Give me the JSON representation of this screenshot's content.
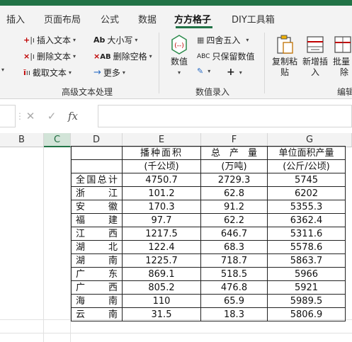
{
  "ribbon_tabs": [
    {
      "label": "插入",
      "active": false
    },
    {
      "label": "页面布局",
      "active": false
    },
    {
      "label": "公式",
      "active": false
    },
    {
      "label": "数据",
      "active": false
    },
    {
      "label": "方方格子",
      "active": true
    },
    {
      "label": "DIY工具箱",
      "active": false
    }
  ],
  "ribbon": {
    "insert_text": "插入文本",
    "delete_text": "删除文本",
    "extract_text": "截取文本",
    "case": "大小写",
    "delete_space": "删除空格",
    "more": "更多",
    "group_text": "高级文本处理",
    "numeric": "数值",
    "round": "四舍五入",
    "keep_value": "只保留数值",
    "group_numeric": "数值录入",
    "copy_paste_line1": "复制粘",
    "copy_paste_line2": "贴",
    "new_insert_line1": "新增插",
    "new_insert_line2": "入",
    "batch_delete_line1": "批量",
    "batch_delete_line2": "除",
    "group_edit": "编辑"
  },
  "formula_bar": {
    "cancel_icon": "✕",
    "enter_icon": "✓",
    "fx_label": "fx",
    "value": ""
  },
  "columns": [
    "B",
    "C",
    "D",
    "E",
    "F",
    "G"
  ],
  "selected_column": "C",
  "table": {
    "header_row1": [
      "",
      "播种面积",
      "总　产　量",
      "单位面积产量"
    ],
    "header_row2": [
      "",
      "(千公顷)",
      "(万吨)",
      "(公斤/公顷)"
    ],
    "rows": [
      [
        "全国总计",
        "4750.7",
        "2729.3",
        "5745"
      ],
      [
        "浙江",
        "101.2",
        "62.8",
        "6202"
      ],
      [
        "安徽",
        "170.3",
        "91.2",
        "5355.3"
      ],
      [
        "福建",
        "97.7",
        "62.2",
        "6362.4"
      ],
      [
        "江西",
        "1217.5",
        "646.7",
        "5311.6"
      ],
      [
        "湖北",
        "122.4",
        "68.3",
        "5578.6"
      ],
      [
        "湖南",
        "1225.7",
        "718.7",
        "5863.7"
      ],
      [
        "广东",
        "869.1",
        "518.5",
        "5966"
      ],
      [
        "广西",
        "805.2",
        "476.8",
        "5921"
      ],
      [
        "海南",
        "110",
        "65.9",
        "5989.5"
      ],
      [
        "云南",
        "31.5",
        "18.3",
        "5806.9"
      ]
    ]
  },
  "colors": {
    "excel_green": "#217346",
    "ribbon_bg": "#f3f3f3"
  }
}
